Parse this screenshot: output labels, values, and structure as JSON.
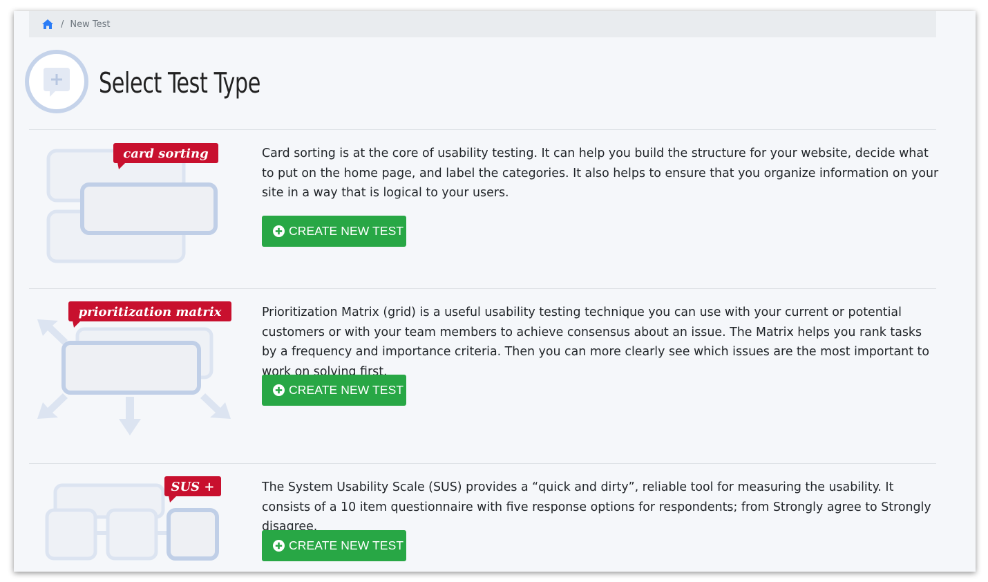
{
  "breadcrumb": {
    "home_icon": "home-icon",
    "current": "New Test"
  },
  "header": {
    "icon": "add-comment-icon",
    "title": "Select Test Type"
  },
  "colors": {
    "accent": "#2b7cf6",
    "button": "#28a745",
    "tag": "#c8102e",
    "illustration": "#c5d3ea"
  },
  "tests": [
    {
      "tag": "card sorting",
      "description": "Card sorting is at the core of usability testing. It can help you build the structure for your website, decide what to put on the home page, and label the categories. It also helps to ensure that you organize information on your site in a way that is logical to your users.",
      "button_label": "CREATE NEW TEST"
    },
    {
      "tag": "prioritization matrix",
      "description": "Prioritization Matrix (grid) is a useful usability testing technique you can use with your current or potential customers or with your team members to achieve consensus about an issue. The Matrix helps you rank tasks by a frequency and importance criteria. Then you can more clearly see which issues are the most important to work on solving first.",
      "button_label": "CREATE NEW TEST"
    },
    {
      "tag": "SUS +",
      "description": "The System Usability Scale (SUS) provides a “quick and dirty”, reliable tool for measuring the usability. It consists of a 10 item questionnaire with five response options for respondents; from Strongly agree to Strongly disagree.",
      "button_label": "CREATE NEW TEST"
    }
  ]
}
